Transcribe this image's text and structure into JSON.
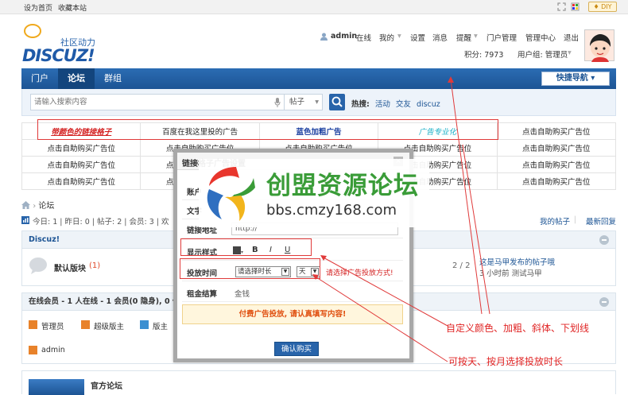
{
  "topbar": {
    "set_home": "设为首页",
    "bookmark": "收藏本站",
    "diy": "DIY"
  },
  "logo": {
    "text": "DISCUZ!",
    "subtitle": "社区动力"
  },
  "user": {
    "name": "admin",
    "status": "在线",
    "links": [
      "我的",
      "设置",
      "消息",
      "提醒",
      "门户管理",
      "管理中心",
      "退出"
    ],
    "points": "积分: 7973",
    "group": "用户组: 管理员"
  },
  "nav": {
    "items": [
      "门户",
      "论坛",
      "群组"
    ],
    "active_index": 1,
    "quick_nav": "快捷导航"
  },
  "search": {
    "placeholder": "请输入搜索内容",
    "type": "帖子",
    "hot_label": "热搜:",
    "hot_items": [
      "活动",
      "交友",
      "discuz"
    ]
  },
  "ads": {
    "row1": [
      "带颜色的链接格子",
      "百度在我这里投的广告",
      "蓝色加粗广告",
      "广告专业化",
      "点击自助购买广告位"
    ],
    "filler": "点击自助购买广告位",
    "colors": {
      "red": "#d31f1f",
      "blue": "#1a3fa0",
      "cyan": "#1ab0c8"
    }
  },
  "breadcrumb": {
    "current": "论坛"
  },
  "stats": {
    "text": "今日: 1 | 昨日: 0 | 帖子: 2 | 会员: 3 | 欢",
    "my_posts": "我的帖子",
    "latest": "最新回复"
  },
  "forum_section": {
    "title": "Discuz!",
    "board_name": "默认版块",
    "board_count": "(1)",
    "ratio": "2 / 2",
    "last_post": "这是马甲发布的帖子哦",
    "last_post_meta": "3 小时前 测试马甲"
  },
  "online": {
    "title": "在线会员 - 1 人在线 - 1 会员(0 隐身), 0 位",
    "legend": [
      "管理员",
      "超级版主",
      "版主"
    ],
    "member": "admin"
  },
  "official": {
    "title": "官方论坛"
  },
  "dialog": {
    "title": "链接格子广告设置",
    "row_labels": [
      "账户",
      "文字",
      "链接地址",
      "显示样式",
      "投放时间",
      "租金结算"
    ],
    "url_value": "http://",
    "style_buttons": [
      "B",
      "I",
      "U"
    ],
    "duration_select": "请选择时长",
    "unit_select": "天",
    "duration_hint": "请选择广告投放方式!",
    "payment": "金钱",
    "notice": "付费广告投放, 请认真填写内容!",
    "confirm": "确认购买"
  },
  "watermark": {
    "title": "创盟资源论坛",
    "url": "bbs.cmzy168.com"
  },
  "annotations": {
    "style_note": "自定义颜色、加粗、斜体、下划线",
    "time_note": "可按天、按月选择投放时长"
  }
}
